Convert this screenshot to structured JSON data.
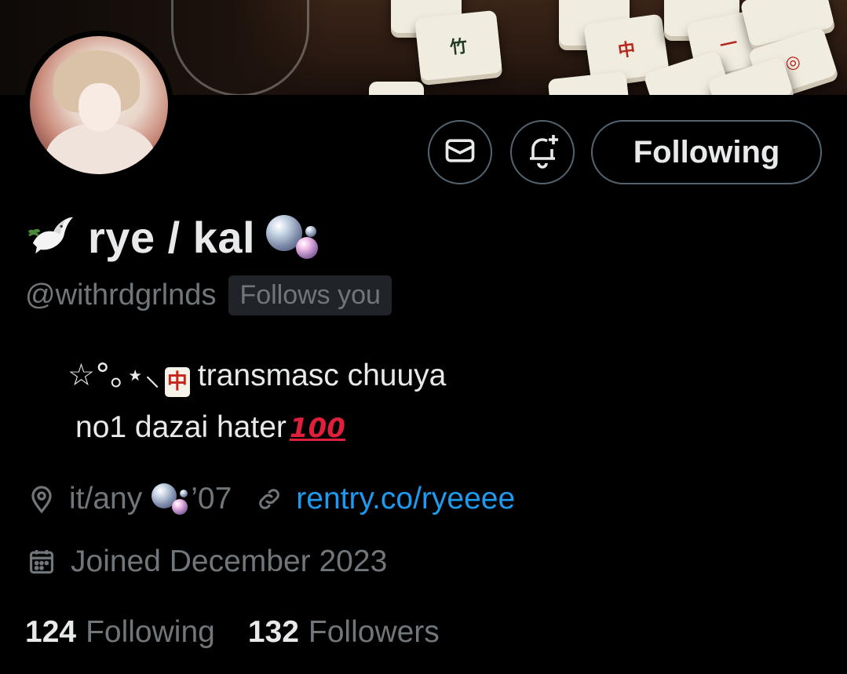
{
  "profile": {
    "display_name": "rye / kal",
    "handle": "@withrdgrlnds",
    "follows_you_badge": "Follows you",
    "bio_line1_symbols": "☆°｡⋆⸜",
    "bio_line1_text": "transmasc chuuya",
    "bio_line2_text": "no1 dazai hater",
    "bio_emoji_tile": "中",
    "bio_emoji_hundred": "100",
    "location": "it/any",
    "location_suffix": "’07",
    "website": "rentry.co/ryeeee",
    "joined": "Joined December 2023"
  },
  "actions": {
    "following_button": "Following"
  },
  "stats": {
    "following_count": "124",
    "following_label": "Following",
    "followers_count": "132",
    "followers_label": "Followers"
  },
  "icons": {
    "message": "envelope-icon",
    "notify": "bell-plus-icon",
    "location": "map-pin-icon",
    "link": "link-icon",
    "calendar": "calendar-icon"
  },
  "colors": {
    "background": "#000000",
    "text_primary": "#e7e9ea",
    "text_secondary": "#71767b",
    "link": "#1d9bf0",
    "border": "#536471"
  }
}
